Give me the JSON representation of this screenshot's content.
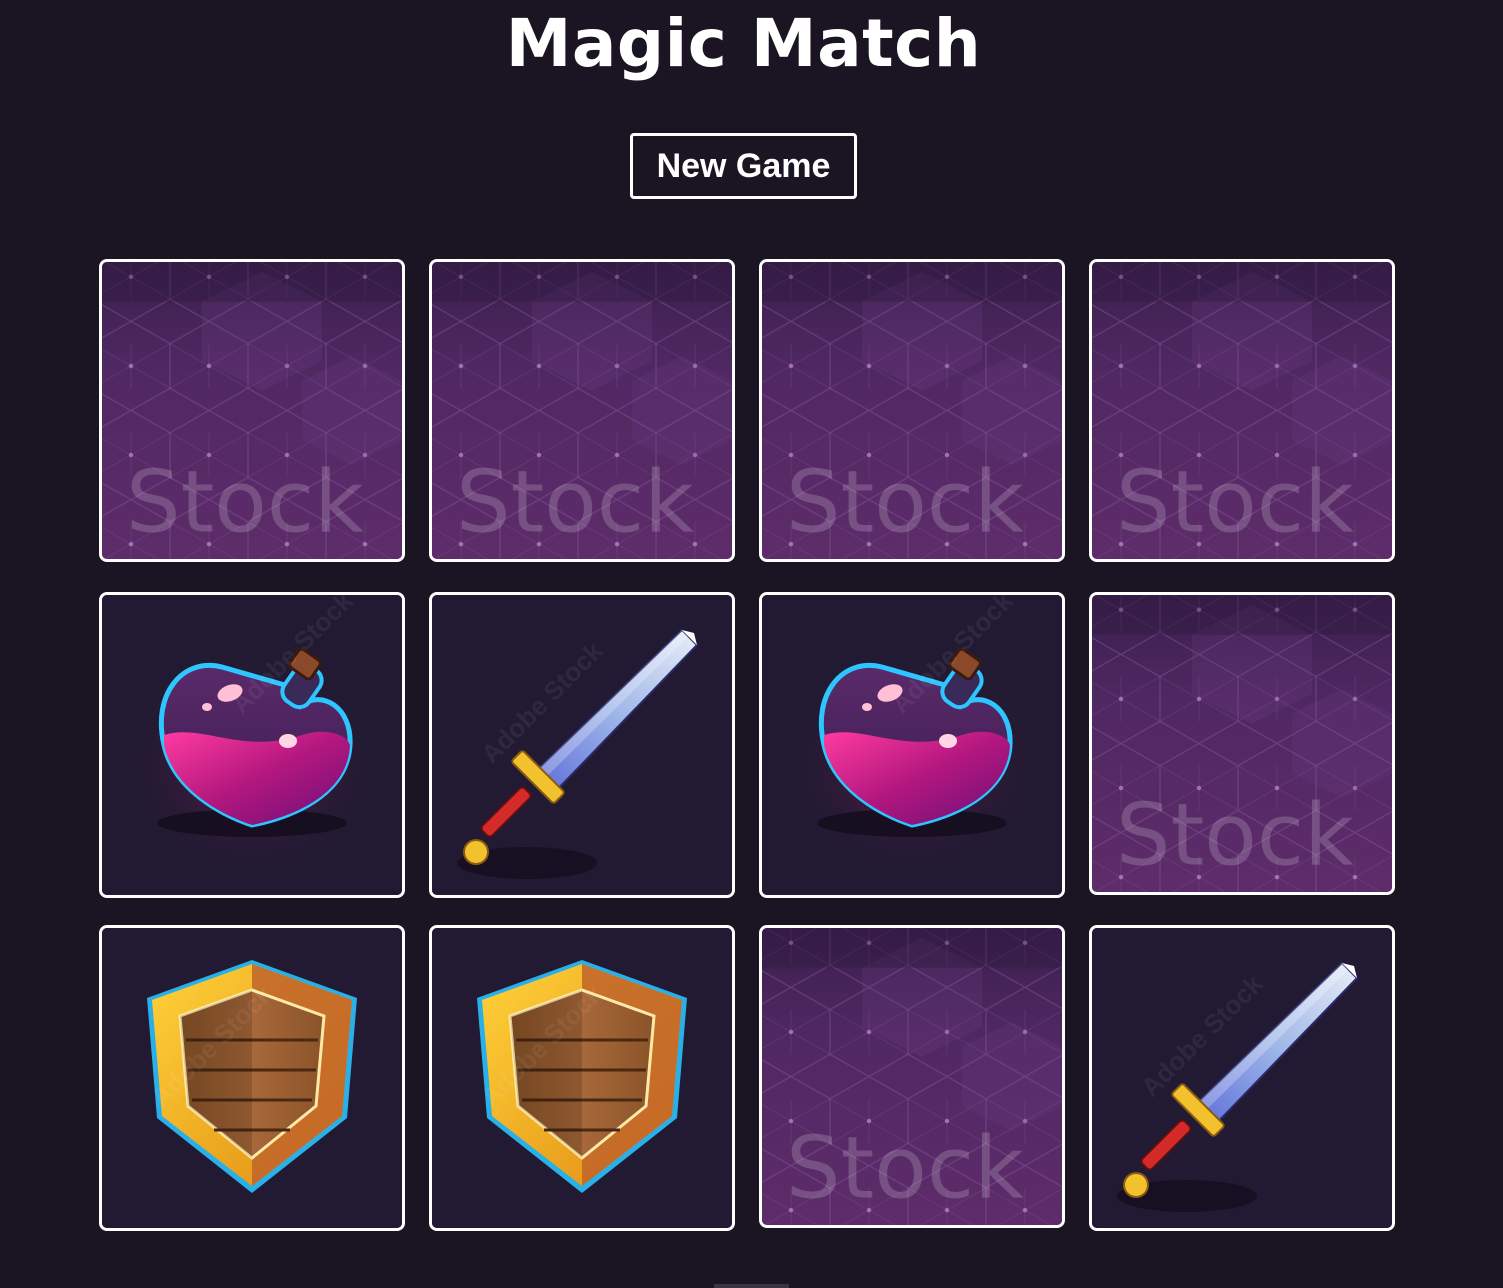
{
  "game": {
    "title": "Magic Match",
    "new_game_label": "New Game",
    "card_back_watermark": "Stock",
    "card_face_watermarks": [
      "Adobe Stock"
    ]
  },
  "colors": {
    "background": "#1b1523",
    "card_back": "#5a2d6e",
    "card_face_bg": "#221a33",
    "border": "#ffffff"
  },
  "board": {
    "rows": 3,
    "columns": 4,
    "cards": [
      {
        "state": "face-down",
        "icon": "card-back-hexagon-pattern"
      },
      {
        "state": "face-down",
        "icon": "card-back-hexagon-pattern"
      },
      {
        "state": "face-down",
        "icon": "card-back-hexagon-pattern"
      },
      {
        "state": "face-down",
        "icon": "card-back-hexagon-pattern"
      },
      {
        "state": "face-up",
        "icon": "potion-icon"
      },
      {
        "state": "face-up",
        "icon": "sword-icon"
      },
      {
        "state": "face-up",
        "icon": "potion-icon"
      },
      {
        "state": "face-down",
        "icon": "card-back-hexagon-pattern"
      },
      {
        "state": "face-up",
        "icon": "shield-icon"
      },
      {
        "state": "face-up",
        "icon": "shield-icon"
      },
      {
        "state": "face-down",
        "icon": "card-back-hexagon-pattern"
      },
      {
        "state": "face-up",
        "icon": "sword-icon"
      }
    ]
  }
}
